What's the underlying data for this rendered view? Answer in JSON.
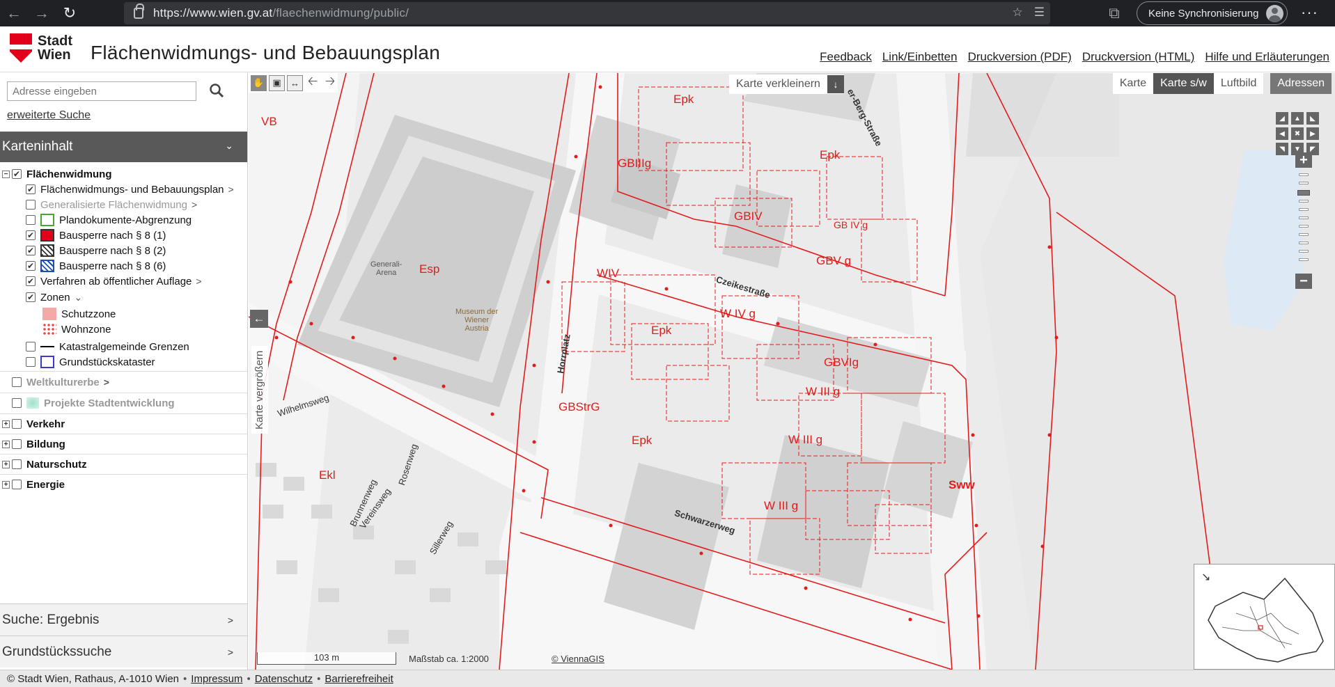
{
  "browser": {
    "url_host": "https://www.wien.gv.at",
    "url_path": "/flaechenwidmung/public/",
    "sync_label": "Keine Synchronisierung",
    "more": "···"
  },
  "header": {
    "logo_line1": "Stadt",
    "logo_line2": "Wien",
    "title": "Flächenwidmungs- und Bebauungsplan",
    "links": [
      "Feedback",
      "Link/Einbetten",
      "Druckversion (PDF)",
      "Druckversion (HTML)",
      "Hilfe und Erläuterungen"
    ]
  },
  "sidebar": {
    "search_placeholder": "Adresse eingeben",
    "advanced_search": "erweiterte Suche",
    "panel_title": "Karteninhalt",
    "layers": {
      "flaechenwidmung": "Flächenwidmung",
      "fwbp": "Flächenwidmungs- und Bebauungsplan",
      "generalisiert": "Generalisierte Flächenwidmung",
      "plandokumente": "Plandokumente-Abgrenzung",
      "bausperre1": "Bausperre nach § 8 (1)",
      "bausperre2": "Bausperre nach § 8 (2)",
      "bausperre6": "Bausperre nach § 8 (6)",
      "verfahren": "Verfahren ab öffentlicher Auflage",
      "zonen": "Zonen",
      "schutzzone": "Schutzzone",
      "wohnzone": "Wohnzone",
      "kataster_grenzen": "Katastralgemeinde Grenzen",
      "grundstueck": "Grundstückskataster",
      "weltkulturerbe": "Weltkulturerbe",
      "projekte": "Projekte Stadtentwicklung",
      "verkehr": "Verkehr",
      "bildung": "Bildung",
      "naturschutz": "Naturschutz",
      "energie": "Energie"
    },
    "bottom_panels": [
      "Suche: Ergebnis",
      "Grundstückssuche"
    ]
  },
  "map": {
    "shrink_label": "Karte verkleinern",
    "type_options": [
      "Karte",
      "Karte s/w",
      "Luftbild"
    ],
    "selected_type": "Karte s/w",
    "addresses": "Adressen",
    "enlarge_label": "Karte vergrößern",
    "scale_bar": "103 m",
    "scale_text": "Maßstab ca. 1:2000",
    "copyright": "© ViennaGIS",
    "labels": {
      "vb": "VB",
      "esp": "Esp",
      "epk1": "Epk",
      "epk2": "Epk",
      "epk3": "Epk",
      "epk4": "Epk",
      "ekl": "Ekl",
      "gbstrg": "GBStrG",
      "sww": "Sww",
      "gbiiig": "GBIIIg",
      "gbiv": "GBIV",
      "gbivg": "GB IV g",
      "wiv": "WIV",
      "wivg": "W IV g",
      "wiiig": "W III g",
      "wiig": "W III g",
      "wiiig2": "W III g",
      "gbvg": "GBV g",
      "gbivg2": "GBVIg"
    },
    "streets": {
      "czeike": "Czeikestraße",
      "horr": "Horrplatz",
      "schwarzer": "Schwarzerweg",
      "berg": "er-Berg-Straße",
      "wilhelm": "Wilhelmsweg",
      "brunnen": "Brunnenweg",
      "verein": "Vereinsweg",
      "rosen": "Rosenweg",
      "siller": "Sillerweg"
    },
    "pois": {
      "arena": "Generali-\nArena",
      "museum": "Museum der\nWiener\nAustria"
    }
  },
  "footer": {
    "copyright": "© Stadt Wien, Rathaus, A-1010 Wien",
    "links": [
      "Impressum",
      "Datenschutz",
      "Barrierefreiheit"
    ]
  }
}
